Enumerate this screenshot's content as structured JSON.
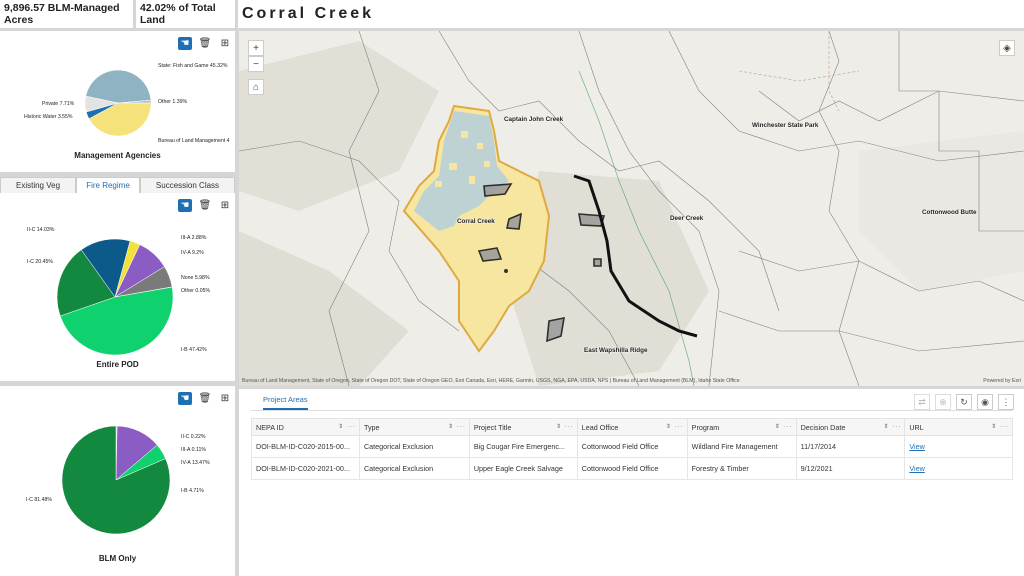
{
  "header": {
    "acres": "9,896.57 BLM-Managed Acres",
    "percent": "42.02% of Total Land",
    "title": "Corral Creek"
  },
  "chart1": {
    "title": "Management Agencies",
    "labels": [
      "State: Fish and Game 45.32%",
      "Other 1.39%",
      "Bureau of Land Management 4",
      "Historic Water 3.55%",
      "Private 7.71%"
    ],
    "chart_data": {
      "type": "pie",
      "title": "Management Agencies",
      "slices": [
        {
          "name": "State: Fish and Game",
          "value": 45.32,
          "color": "#8fb3c2"
        },
        {
          "name": "Other",
          "value": 1.39,
          "color": "#b7c0c4"
        },
        {
          "name": "Bureau of Land Management",
          "value": 42.03,
          "color": "#f6e27a"
        },
        {
          "name": "Historic Water",
          "value": 3.55,
          "color": "#1f6fb5"
        },
        {
          "name": "Private",
          "value": 7.71,
          "color": "#e3e3e3"
        }
      ]
    }
  },
  "tabs": [
    "Existing Veg",
    "Fire Regime",
    "Succession Class"
  ],
  "chart2": {
    "title": "Entire POD",
    "labels": [
      "II-C 14.03%",
      "III-A 2.88%",
      "IV-A 9.2%",
      "None 5.98%",
      "Other 0.05%",
      "I-B 47.42%",
      "I-C 20.45%"
    ],
    "chart_data": {
      "type": "pie",
      "title": "Entire POD",
      "slices": [
        {
          "name": "III-A",
          "value": 2.88,
          "color": "#f2e13a"
        },
        {
          "name": "IV-A",
          "value": 9.2,
          "color": "#8a5cc4"
        },
        {
          "name": "None",
          "value": 5.98,
          "color": "#7a7a7a"
        },
        {
          "name": "Other",
          "value": 0.05,
          "color": "#444444"
        },
        {
          "name": "I-B",
          "value": 47.42,
          "color": "#0fd26f"
        },
        {
          "name": "I-C",
          "value": 20.45,
          "color": "#13883f"
        },
        {
          "name": "II-C",
          "value": 14.03,
          "color": "#0b5a8a"
        }
      ]
    }
  },
  "chart3": {
    "title": "BLM Only",
    "labels": [
      "II-C 0.22%",
      "III-A 0.11%",
      "IV-A 13.47%",
      "I-B 4.71%",
      "I-C 81.48%"
    ],
    "chart_data": {
      "type": "pie",
      "title": "BLM Only",
      "slices": [
        {
          "name": "II-C",
          "value": 0.22,
          "color": "#0b5a8a"
        },
        {
          "name": "III-A",
          "value": 0.11,
          "color": "#f2e13a"
        },
        {
          "name": "IV-A",
          "value": 13.47,
          "color": "#8a5cc4"
        },
        {
          "name": "I-B",
          "value": 4.71,
          "color": "#0fd26f"
        },
        {
          "name": "I-C",
          "value": 81.48,
          "color": "#13883f"
        }
      ]
    }
  },
  "map": {
    "labels": [
      "Captain John Creek",
      "Winchester State Park",
      "Corral Creek",
      "Deer Creek",
      "Cottonwood Butte",
      "East Wapshilla Ridge"
    ],
    "zoom_in": "+",
    "zoom_out": "−",
    "attribution": "Bureau of Land Management, State of Oregon, State of Oregon DOT, State of Oregon GEO, Esri Canada, Esri, HERE, Garmin, USGS, NGA, EPA, USDA, NPS | Bureau of Land Management (BLM), Idaho State Office",
    "powered": "Powered by Esri"
  },
  "table": {
    "tab": "Project Areas",
    "columns": [
      "NEPA ID",
      "Type",
      "Project Title",
      "Lead Office",
      "Program",
      "Decision Date",
      "URL"
    ],
    "rows": [
      [
        "DOI-BLM-ID-C020-2015-00...",
        "Categorical Exclusion",
        "Big Cougar Fire Emergenc...",
        "Cottonwood Field Office",
        "Wildland Fire Management",
        "11/17/2014",
        "View"
      ],
      [
        "DOI-BLM-ID-C020-2021-00...",
        "Categorical Exclusion",
        "Upper Eagle Creek Salvage",
        "Cottonwood Field Office",
        "Forestry & Timber",
        "9/12/2021",
        "View"
      ]
    ]
  }
}
